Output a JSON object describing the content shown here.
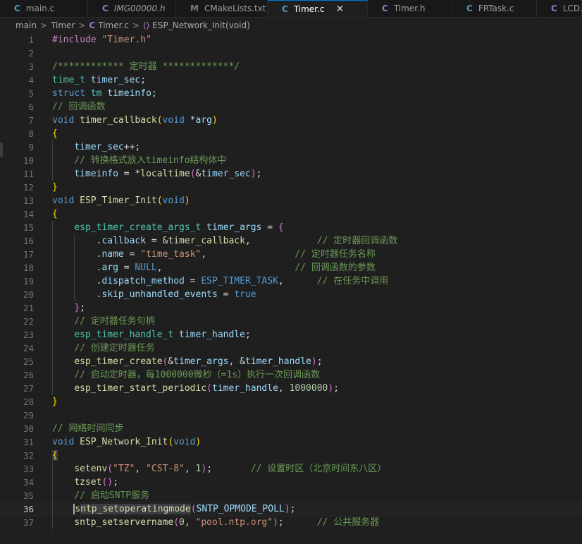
{
  "tabs": [
    {
      "icon": "C",
      "label": "main.c",
      "color": "#519aba",
      "italic": false,
      "active": false
    },
    {
      "icon": "C",
      "label": "IMG00000.h",
      "color": "#a074c4",
      "italic": true,
      "active": false
    },
    {
      "icon": "M",
      "label": "CMakeLists.txt",
      "color": "#6d8086",
      "italic": false,
      "active": false
    },
    {
      "icon": "C",
      "label": "Timer.c",
      "color": "#519aba",
      "italic": false,
      "active": true,
      "close": "✕"
    },
    {
      "icon": "C",
      "label": "Timer.h",
      "color": "#a074c4",
      "italic": false,
      "active": false
    },
    {
      "icon": "C",
      "label": "FRTask.c",
      "color": "#519aba",
      "italic": false,
      "active": false
    },
    {
      "icon": "C",
      "label": "LCD.h",
      "color": "#a074c4",
      "italic": false,
      "active": false
    }
  ],
  "breadcrumb": {
    "items": [
      "main",
      "Timer",
      "Timer.c",
      "ESP_Network_Init(void)"
    ],
    "separator": ">",
    "file_icon": "C",
    "func_icon": "⟨⟩"
  },
  "editor": {
    "current_line": 36,
    "lines": [
      {
        "n": "1",
        "t": [
          [
            "m",
            "#include"
          ],
          [
            "p",
            " "
          ],
          [
            "s",
            "\"Timer.h\""
          ]
        ]
      },
      {
        "n": "2",
        "t": []
      },
      {
        "n": "3",
        "t": [
          [
            "c",
            "/************ 定时器 *************/"
          ]
        ]
      },
      {
        "n": "4",
        "t": [
          [
            "t",
            "time_t"
          ],
          [
            "p",
            " "
          ],
          [
            "v",
            "timer_sec"
          ],
          [
            "p",
            ";"
          ]
        ]
      },
      {
        "n": "5",
        "t": [
          [
            "k",
            "struct"
          ],
          [
            "p",
            " "
          ],
          [
            "t",
            "tm"
          ],
          [
            "p",
            " "
          ],
          [
            "v",
            "timeinfo"
          ],
          [
            "p",
            ";"
          ]
        ]
      },
      {
        "n": "6",
        "t": [
          [
            "c",
            "// 回调函数"
          ]
        ]
      },
      {
        "n": "7",
        "t": [
          [
            "k",
            "void"
          ],
          [
            "p",
            " "
          ],
          [
            "f",
            "timer_callback"
          ],
          [
            "b1",
            "("
          ],
          [
            "k",
            "void"
          ],
          [
            "p",
            " *"
          ],
          [
            "v",
            "arg"
          ],
          [
            "b1",
            ")"
          ]
        ]
      },
      {
        "n": "8",
        "t": [
          [
            "b1",
            "{"
          ]
        ]
      },
      {
        "n": "9",
        "g": 1,
        "t": [
          [
            "p",
            "    "
          ],
          [
            "v",
            "timer_sec"
          ],
          [
            "p",
            "++;"
          ]
        ]
      },
      {
        "n": "10",
        "g": 1,
        "t": [
          [
            "p",
            "    "
          ],
          [
            "c",
            "// 转换格式放入timeinfo结构体中"
          ]
        ]
      },
      {
        "n": "11",
        "g": 1,
        "t": [
          [
            "p",
            "    "
          ],
          [
            "v",
            "timeinfo"
          ],
          [
            "p",
            " = *"
          ],
          [
            "f",
            "localtime"
          ],
          [
            "b2",
            "("
          ],
          [
            "p",
            "&"
          ],
          [
            "v",
            "timer_sec"
          ],
          [
            "b2",
            ")"
          ],
          [
            "p",
            ";"
          ]
        ]
      },
      {
        "n": "12",
        "t": [
          [
            "b1",
            "}"
          ]
        ]
      },
      {
        "n": "13",
        "t": [
          [
            "k",
            "void"
          ],
          [
            "p",
            " "
          ],
          [
            "f",
            "ESP_Timer_Init"
          ],
          [
            "b1",
            "("
          ],
          [
            "k",
            "void"
          ],
          [
            "b1",
            ")"
          ]
        ]
      },
      {
        "n": "14",
        "t": [
          [
            "b1",
            "{"
          ]
        ]
      },
      {
        "n": "15",
        "g": 1,
        "t": [
          [
            "p",
            "    "
          ],
          [
            "t",
            "esp_timer_create_args_t"
          ],
          [
            "p",
            " "
          ],
          [
            "v",
            "timer_args"
          ],
          [
            "p",
            " = "
          ],
          [
            "b2",
            "{"
          ]
        ]
      },
      {
        "n": "16",
        "g": 2,
        "t": [
          [
            "p",
            "        ."
          ],
          [
            "v",
            "callback"
          ],
          [
            "p",
            " = &"
          ],
          [
            "f",
            "timer_callback"
          ],
          [
            "p",
            ",            "
          ],
          [
            "c",
            "// 定时器回调函数"
          ]
        ]
      },
      {
        "n": "17",
        "g": 2,
        "t": [
          [
            "p",
            "        ."
          ],
          [
            "v",
            "name"
          ],
          [
            "p",
            " = "
          ],
          [
            "s",
            "\"time_task\""
          ],
          [
            "p",
            ",                "
          ],
          [
            "c",
            "// 定时器任务名称"
          ]
        ]
      },
      {
        "n": "18",
        "g": 2,
        "t": [
          [
            "p",
            "        ."
          ],
          [
            "v",
            "arg"
          ],
          [
            "p",
            " = "
          ],
          [
            "k",
            "NULL"
          ],
          [
            "p",
            ",                        "
          ],
          [
            "c",
            "// 回调函数的参数"
          ]
        ]
      },
      {
        "n": "19",
        "g": 2,
        "t": [
          [
            "p",
            "        ."
          ],
          [
            "v",
            "dispatch_method"
          ],
          [
            "p",
            " = "
          ],
          [
            "k",
            "ESP_TIMER_TASK"
          ],
          [
            "p",
            ",      "
          ],
          [
            "c",
            "// 在任务中调用"
          ]
        ]
      },
      {
        "n": "20",
        "g": 2,
        "t": [
          [
            "p",
            "        ."
          ],
          [
            "v",
            "skip_unhandled_events"
          ],
          [
            "p",
            " = "
          ],
          [
            "k",
            "true"
          ]
        ]
      },
      {
        "n": "21",
        "g": 1,
        "t": [
          [
            "p",
            "    "
          ],
          [
            "b2",
            "}"
          ],
          [
            "p",
            ";"
          ]
        ]
      },
      {
        "n": "22",
        "g": 1,
        "t": [
          [
            "p",
            "    "
          ],
          [
            "c",
            "// 定时器任务句柄"
          ]
        ]
      },
      {
        "n": "23",
        "g": 1,
        "t": [
          [
            "p",
            "    "
          ],
          [
            "t",
            "esp_timer_handle_t"
          ],
          [
            "p",
            " "
          ],
          [
            "v",
            "timer_handle"
          ],
          [
            "p",
            ";"
          ]
        ]
      },
      {
        "n": "24",
        "g": 1,
        "t": [
          [
            "p",
            "    "
          ],
          [
            "c",
            "// 创建定时器任务"
          ]
        ]
      },
      {
        "n": "25",
        "g": 1,
        "t": [
          [
            "p",
            "    "
          ],
          [
            "f",
            "esp_timer_create"
          ],
          [
            "b2",
            "("
          ],
          [
            "p",
            "&"
          ],
          [
            "v",
            "timer_args"
          ],
          [
            "p",
            ", &"
          ],
          [
            "v",
            "timer_handle"
          ],
          [
            "b2",
            ")"
          ],
          [
            "p",
            ";"
          ]
        ]
      },
      {
        "n": "26",
        "g": 1,
        "t": [
          [
            "p",
            "    "
          ],
          [
            "c",
            "// 启动定时器，每1000000微秒（=1s）执行一次回调函数"
          ]
        ]
      },
      {
        "n": "27",
        "g": 1,
        "t": [
          [
            "p",
            "    "
          ],
          [
            "f",
            "esp_timer_start_periodic"
          ],
          [
            "b2",
            "("
          ],
          [
            "v",
            "timer_handle"
          ],
          [
            "p",
            ", "
          ],
          [
            "n",
            "1000000"
          ],
          [
            "b2",
            ")"
          ],
          [
            "p",
            ";"
          ]
        ]
      },
      {
        "n": "28",
        "t": [
          [
            "b1",
            "}"
          ]
        ]
      },
      {
        "n": "29",
        "t": []
      },
      {
        "n": "30",
        "t": [
          [
            "c",
            "// 网络时间同步"
          ]
        ]
      },
      {
        "n": "31",
        "t": [
          [
            "k",
            "void"
          ],
          [
            "p",
            " "
          ],
          [
            "f",
            "ESP_Network_Init"
          ],
          [
            "b1",
            "("
          ],
          [
            "k",
            "void"
          ],
          [
            "b1",
            ")"
          ]
        ]
      },
      {
        "n": "32",
        "t": [
          [
            "b1 hl",
            "{"
          ]
        ]
      },
      {
        "n": "33",
        "g": 1,
        "t": [
          [
            "p",
            "    "
          ],
          [
            "f",
            "setenv"
          ],
          [
            "b2",
            "("
          ],
          [
            "s",
            "\"TZ\""
          ],
          [
            "p",
            ", "
          ],
          [
            "s",
            "\"CST-8\""
          ],
          [
            "p",
            ", "
          ],
          [
            "n",
            "1"
          ],
          [
            "b2",
            ")"
          ],
          [
            "p",
            ";       "
          ],
          [
            "c",
            "// 设置时区（北京时间东八区）"
          ]
        ]
      },
      {
        "n": "34",
        "g": 1,
        "t": [
          [
            "p",
            "    "
          ],
          [
            "f",
            "tzset"
          ],
          [
            "b2",
            "()"
          ],
          [
            "p",
            ";"
          ]
        ]
      },
      {
        "n": "35",
        "g": 1,
        "t": [
          [
            "p",
            "    "
          ],
          [
            "c",
            "// 启动SNTP服务"
          ]
        ]
      },
      {
        "n": "36",
        "g": 1,
        "t": [
          [
            "p",
            "    "
          ],
          [
            "f cursor",
            "s"
          ],
          [
            "f hl",
            "ntp_setoperatingmode"
          ],
          [
            "b2",
            "("
          ],
          [
            "v",
            "SNTP_OPMODE_POLL"
          ],
          [
            "b2",
            ")"
          ],
          [
            "p",
            ";"
          ]
        ]
      },
      {
        "n": "37",
        "g": 1,
        "t": [
          [
            "p",
            "    "
          ],
          [
            "f",
            "sntp_setservername"
          ],
          [
            "b2",
            "("
          ],
          [
            "n",
            "0"
          ],
          [
            "p",
            ", "
          ],
          [
            "s",
            "\"pool.ntp.org\""
          ],
          [
            "b2",
            ")"
          ],
          [
            "p",
            ";      "
          ],
          [
            "c",
            "// 公共服务器"
          ]
        ]
      }
    ]
  }
}
